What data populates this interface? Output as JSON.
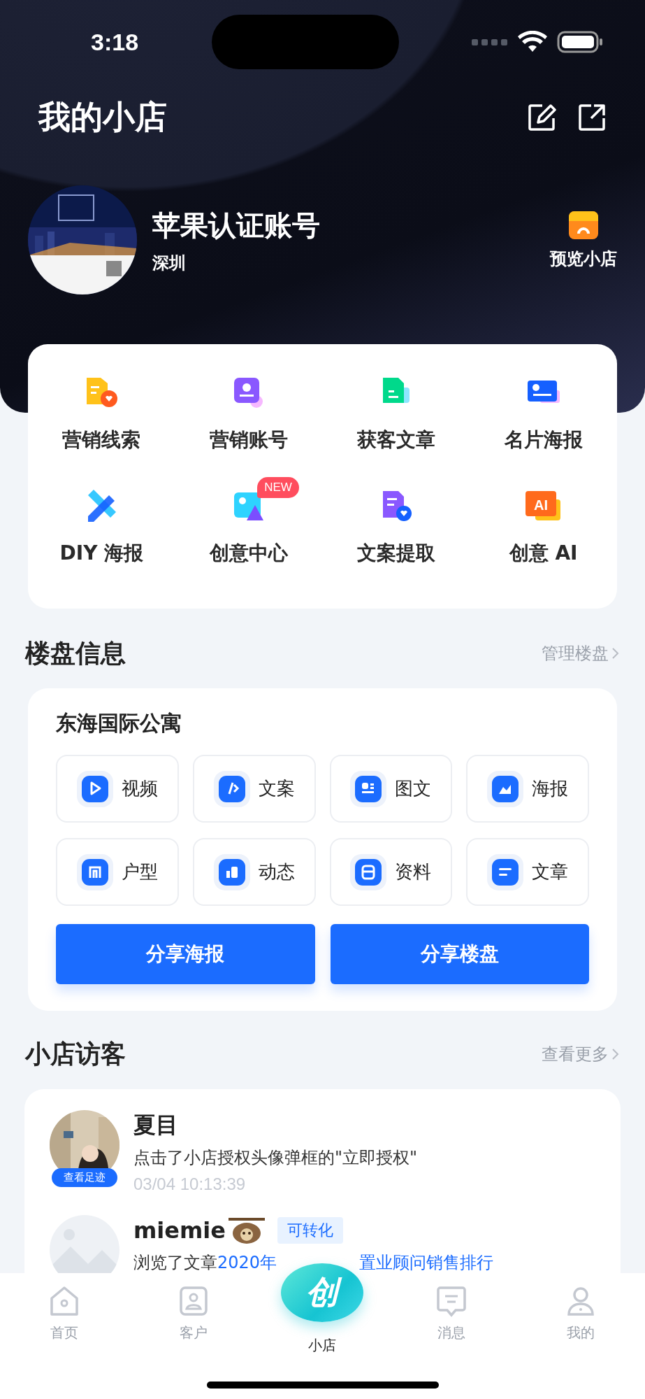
{
  "status_bar": {
    "time": "3:18"
  },
  "header": {
    "title": "我的小店"
  },
  "profile": {
    "name": "苹果认证账号",
    "city": "深圳",
    "preview_label": "预览小店"
  },
  "tools": [
    {
      "label": "营销线索"
    },
    {
      "label": "营销账号"
    },
    {
      "label": "获客文章"
    },
    {
      "label": "名片海报"
    },
    {
      "label": "DIY 海报"
    },
    {
      "label": "创意中心",
      "badge": "NEW"
    },
    {
      "label": "文案提取"
    },
    {
      "label": "创意 AI",
      "icon_text": "AI"
    }
  ],
  "property": {
    "section_title": "楼盘信息",
    "manage_link": "管理楼盘",
    "name": "东海国际公寓",
    "actions": [
      "视频",
      "文案",
      "图文",
      "海报",
      "户型",
      "动态",
      "资料",
      "文章"
    ],
    "buttons": [
      "分享海报",
      "分享楼盘"
    ]
  },
  "visitors": {
    "section_title": "小店访客",
    "more_link": "查看更多",
    "items": [
      {
        "name": "夏目",
        "footprint": "查看足迹",
        "description": "点击了小店授权头像弹框的\"立即授权\"",
        "time": "03/04 10:13:39"
      },
      {
        "name": "miemie",
        "tag": "可转化",
        "description": "浏览了文章",
        "link_parts": [
          "2020年",
          "置业顾问销售排行"
        ]
      }
    ]
  },
  "tab_bar": {
    "center_button": "创",
    "items": [
      {
        "label": "首页",
        "selected": false
      },
      {
        "label": "客户",
        "selected": false
      },
      {
        "label": "小店",
        "selected": true
      },
      {
        "label": "消息",
        "selected": false
      },
      {
        "label": "我的",
        "selected": false
      }
    ]
  }
}
